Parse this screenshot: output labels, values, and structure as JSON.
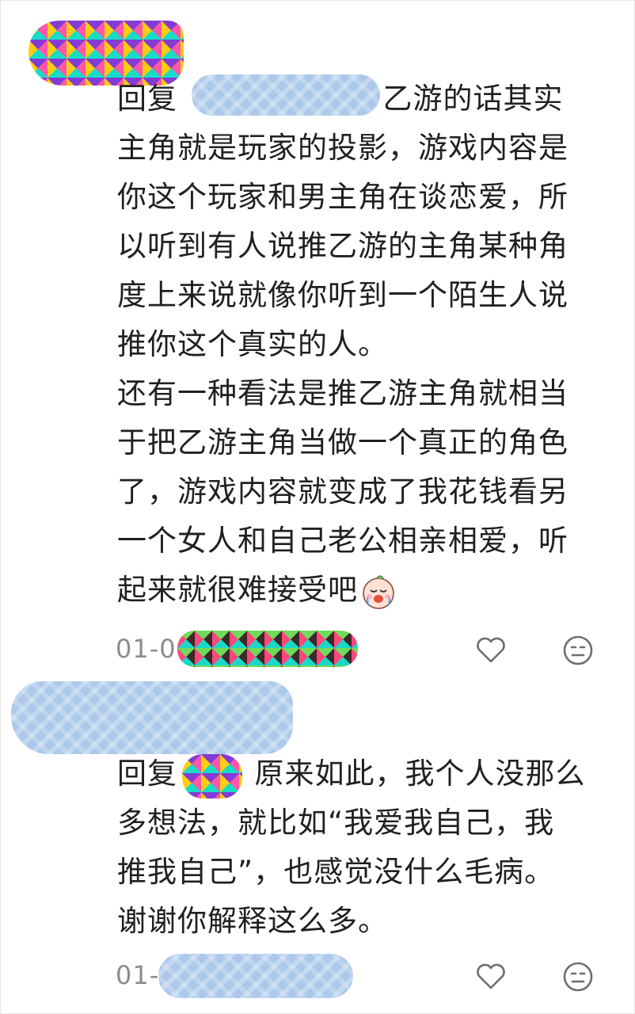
{
  "comments": [
    {
      "reply_prefix": "回复",
      "text": "乙游的话其实\n主角就是玩家的投影，游戏内容是\n你这个玩家和男主角在谈恋爱，所\n以听到有人说推乙游的主角某种角\n度上来说就像你听到一个陌生人说\n推你这个真实的人。\n还有一种看法是推乙游主角就相当\n于把乙游主角当做一个真正的角色\n了，游戏内容就变成了我花钱看另\n一个女人和自己老公相亲相爱，听\n起来就很难接受吧",
      "emoji": "crying-baby-emoji",
      "date_prefix": "01-0",
      "like_icon": "heart-outline-icon",
      "reaction_icon": "neutral-face-icon"
    },
    {
      "reply_prefix": "回复",
      "text": "原来如此，我个人没那么\n多想法，就比如“我爱我自己，我\n推我自己”，也感觉没什么毛病。\n谢谢你解释这么多。",
      "date_prefix": "01-",
      "like_icon": "heart-outline-icon",
      "reaction_icon": "neutral-face-icon"
    }
  ],
  "colors": {
    "text": "#202020",
    "meta": "#8c8c8c",
    "icon": "#6e6e6e",
    "redaction_blue": "#a8c6ea"
  }
}
